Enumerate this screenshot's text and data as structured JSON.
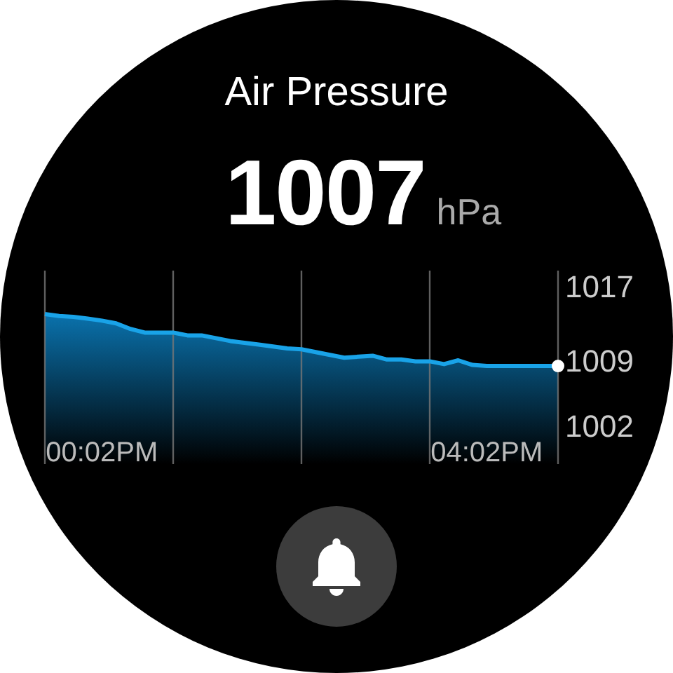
{
  "title": "Air Pressure",
  "reading": {
    "value": "1007",
    "unit": "hPa"
  },
  "chart": {
    "chart_data": {
      "type": "area",
      "categories": [
        null,
        null,
        null,
        null,
        "00:02PM",
        null,
        null,
        null,
        null,
        null,
        null,
        null,
        null,
        null,
        null,
        null,
        null,
        null,
        null,
        null,
        null,
        null,
        null,
        null,
        null,
        null,
        null,
        null,
        null,
        null,
        null,
        "04:02PM",
        null,
        null,
        null,
        null,
        null
      ],
      "series": [
        {
          "color": "#19a3e8",
          "values": [
            1014.0,
            1013.8,
            1013.7,
            1013.5,
            1013.3,
            1013.0,
            1012.4,
            1012.0,
            1012.0,
            1012.0,
            1011.7,
            1011.7,
            1011.4,
            1011.1,
            1010.9,
            1010.7,
            1010.5,
            1010.3,
            1010.2,
            1009.9,
            1009.6,
            1009.3,
            1009.4,
            1009.5,
            1009.1,
            1009.1,
            1008.9,
            1008.9,
            1008.6,
            1009.0,
            1008.5,
            1008.4,
            1008.4,
            1008.4,
            1008.4,
            1008.4,
            1008.4
          ]
        }
      ],
      "ylim": [
        997.8,
        1018.7
      ],
      "yticks": [
        1017,
        1009,
        1002
      ]
    }
  }
}
